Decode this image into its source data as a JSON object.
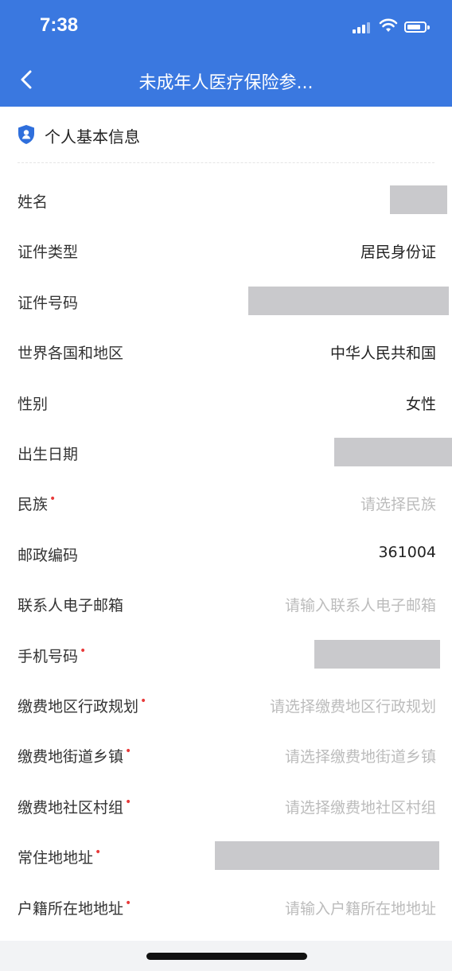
{
  "status_bar": {
    "time": "7:38",
    "signal_icon": "cellular-signal-icon",
    "wifi_icon": "wifi-icon",
    "battery_icon": "battery-icon"
  },
  "nav": {
    "back_icon": "chevron-left-icon",
    "title": "未成年人医疗保险参..."
  },
  "section": {
    "icon": "shield-user-icon",
    "title": "个人基本信息"
  },
  "colors": {
    "header_bg": "#3a78e0",
    "required_mark": "#e83a3a",
    "placeholder_text": "#bcbcbc",
    "redaction": "#c9c9cc"
  },
  "fields": [
    {
      "label": "姓名",
      "required": false,
      "value": "",
      "placeholder": "",
      "redacted": true
    },
    {
      "label": "证件类型",
      "required": false,
      "value": "居民身份证",
      "placeholder": "",
      "redacted": false
    },
    {
      "label": "证件号码",
      "required": false,
      "value": "",
      "placeholder": "",
      "redacted": true
    },
    {
      "label": "世界各国和地区",
      "required": false,
      "value": "中华人民共和国",
      "placeholder": "",
      "redacted": false
    },
    {
      "label": "性别",
      "required": false,
      "value": "女性",
      "placeholder": "",
      "redacted": false
    },
    {
      "label": "出生日期",
      "required": false,
      "value": "",
      "placeholder": "",
      "redacted": true
    },
    {
      "label": "民族",
      "required": true,
      "value": "",
      "placeholder": "请选择民族",
      "redacted": false
    },
    {
      "label": "邮政编码",
      "required": false,
      "value": "361004",
      "placeholder": "",
      "redacted": false
    },
    {
      "label": "联系人电子邮箱",
      "required": false,
      "value": "",
      "placeholder": "请输入联系人电子邮箱",
      "redacted": false
    },
    {
      "label": "手机号码",
      "required": true,
      "value": "",
      "placeholder": "",
      "redacted": true
    },
    {
      "label": "缴费地区行政规划",
      "required": true,
      "value": "",
      "placeholder": "请选择缴费地区行政规划",
      "redacted": false
    },
    {
      "label": "缴费地街道乡镇",
      "required": true,
      "value": "",
      "placeholder": "请选择缴费地街道乡镇",
      "redacted": false
    },
    {
      "label": "缴费地社区村组",
      "required": true,
      "value": "",
      "placeholder": "请选择缴费地社区村组",
      "redacted": false
    },
    {
      "label": "常住地地址",
      "required": true,
      "value": "",
      "placeholder": "",
      "redacted": true
    },
    {
      "label": "户籍所在地地址",
      "required": true,
      "value": "",
      "placeholder": "请输入户籍所在地地址",
      "redacted": false
    }
  ]
}
